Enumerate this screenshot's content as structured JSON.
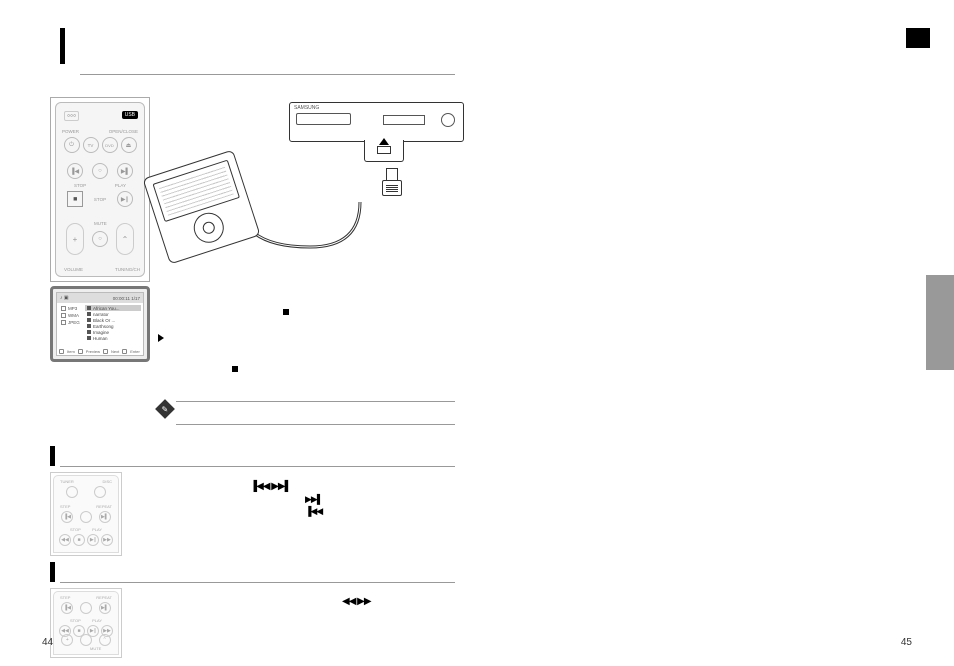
{
  "page_left_number": "44",
  "page_right_number": "45",
  "remote_large": {
    "btn_usb": "USB",
    "label_power": "POWER",
    "label_open_close": "OPEN/CLOSE",
    "label_tv": "TV",
    "label_dvd": "DVD",
    "label_stop": "STOP",
    "label_play": "PLAY",
    "label_stop2": "STOP",
    "label_volume": "VOLUME",
    "label_mute": "MUTE",
    "label_tuning": "TUNING/CH"
  },
  "osd": {
    "title_icons": "♪  ▣",
    "title_right": "00:00:11  1/17",
    "side_mp3": "MP3",
    "side_wma": "WMA",
    "side_jpeg": "JPEG",
    "list": [
      "African You...",
      "narrator",
      "Black Or ...",
      "Earthsong",
      "Imagine",
      "Human"
    ],
    "footer_item1": "Item",
    "footer_item2": "Preview",
    "footer_item3": "Next",
    "footer_item4": "Enter"
  },
  "illustration": {
    "brand": "SAMSUNG"
  },
  "skip_section": {
    "icons": "▐◀◀ ▶▶▌",
    "fwd": "▶▶▌",
    "back": "▐◀◀"
  },
  "ff_section": {
    "icons": "◀◀ ▶▶"
  },
  "table": {
    "col1": "",
    "col2": "",
    "col3": "",
    "col4": "",
    "col5": "",
    "col6": "",
    "row1": "",
    "row2": "",
    "row3": ""
  }
}
